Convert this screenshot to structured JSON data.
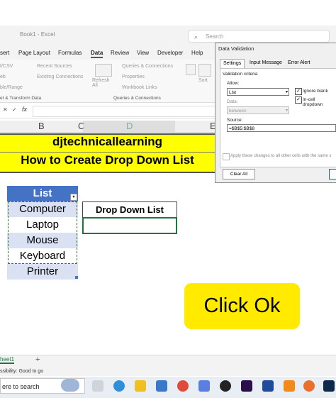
{
  "window": {
    "title": "Book1 - Excel",
    "search_placeholder": "Search"
  },
  "ribbon_tabs": [
    {
      "label": "sert"
    },
    {
      "label": "Page Layout"
    },
    {
      "label": "Formulas"
    },
    {
      "label": "Data"
    },
    {
      "label": "Review"
    },
    {
      "label": "View"
    },
    {
      "label": "Developer"
    },
    {
      "label": "Help"
    }
  ],
  "ribbon": {
    "get_data_items": [
      "t/CSV",
      "eb",
      "ble/Range"
    ],
    "recent_sources": "Recent Sources",
    "existing_connections": "Existing Connections",
    "refresh_all": "Refresh All",
    "queries_connections": "Queries & Connections",
    "properties": "Properties",
    "workbook_links": "Workbook Links",
    "sort": "Sort",
    "group_get_transform": "et & Transform Data",
    "group_queries": "Queries & Connections"
  },
  "formula_bar": {
    "fx": "fx",
    "cancel": "✕",
    "confirm": "✓"
  },
  "columns": [
    "B",
    "C",
    "D",
    "E"
  ],
  "banner": {
    "line1": "djtechnicallearning",
    "line2": "How to Create Drop Down List"
  },
  "list_table": {
    "header": "List",
    "items": [
      "Computer",
      "Laptop",
      "Mouse",
      "Keyboard",
      "Printer"
    ]
  },
  "drop_down": {
    "header": "Drop Down List",
    "value": ""
  },
  "callout": {
    "text": "Click Ok"
  },
  "dialog": {
    "title": "Data Validation",
    "tabs": [
      "Settings",
      "Input Message",
      "Error Alert"
    ],
    "criteria_label": "Validation criteria",
    "allow_label": "Allow:",
    "allow_value": "List",
    "data_label": "Data:",
    "data_value": "between",
    "ignore_blank": "Ignore blank",
    "in_cell_dropdown": "In-cell dropdown",
    "source_label": "Source:",
    "source_value": "=$B$5:$B$8",
    "apply_all": "Apply these changes to all other cells with the same s",
    "clear_all": "Clear All"
  },
  "sheet": {
    "tab": "heet1",
    "add": "+"
  },
  "status": {
    "text": "ssibility: Good to go"
  },
  "taskbar": {
    "search_text": "ere to search"
  },
  "colors": {
    "header_blue": "#4472c4",
    "band_blue": "#d9e1f2",
    "banner_yellow": "#ffff00",
    "callout_yellow": "#ffea00",
    "excel_green": "#217346"
  }
}
